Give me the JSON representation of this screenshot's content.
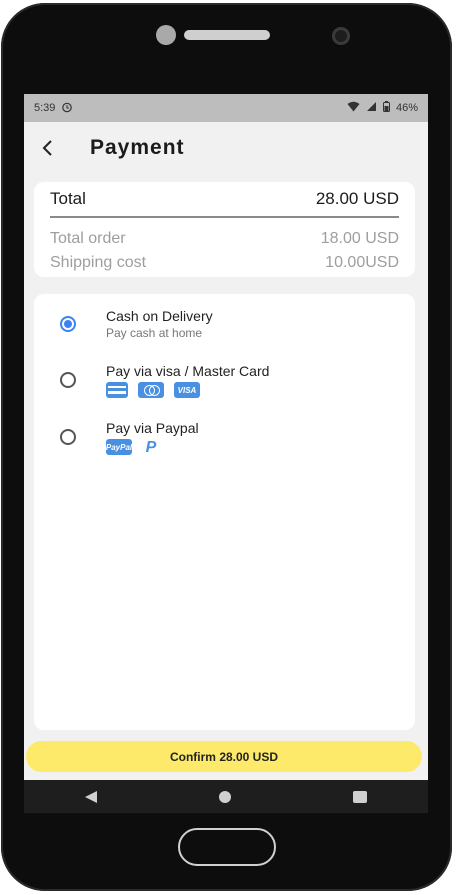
{
  "statusbar": {
    "time": "5:39",
    "battery": "46%"
  },
  "header": {
    "title": "Payment"
  },
  "summary": {
    "total_label": "Total",
    "total_value": "28.00 USD",
    "order_label": "Total order",
    "order_value": "18.00 USD",
    "shipping_label": "Shipping cost",
    "shipping_value": "10.00USD"
  },
  "methods": [
    {
      "title": "Cash on Delivery",
      "subtitle": "Pay cash at home",
      "selected": true
    },
    {
      "title": "Pay via visa / Master Card",
      "icons": [
        "credit-card-icon",
        "mastercard-icon",
        "visa-icon"
      ],
      "visa_text": "VISA"
    },
    {
      "title": "Pay via Paypal",
      "icons": [
        "paypal-text-icon",
        "paypal-logo-icon"
      ],
      "paypal_text": "PayPal",
      "paypal_logo": "P"
    }
  ],
  "confirm": {
    "label": "Confirm 28.00 USD"
  },
  "colors": {
    "accent": "#3b82f6",
    "confirm_bg": "#fde96a",
    "card_icon": "#4a90e2"
  }
}
